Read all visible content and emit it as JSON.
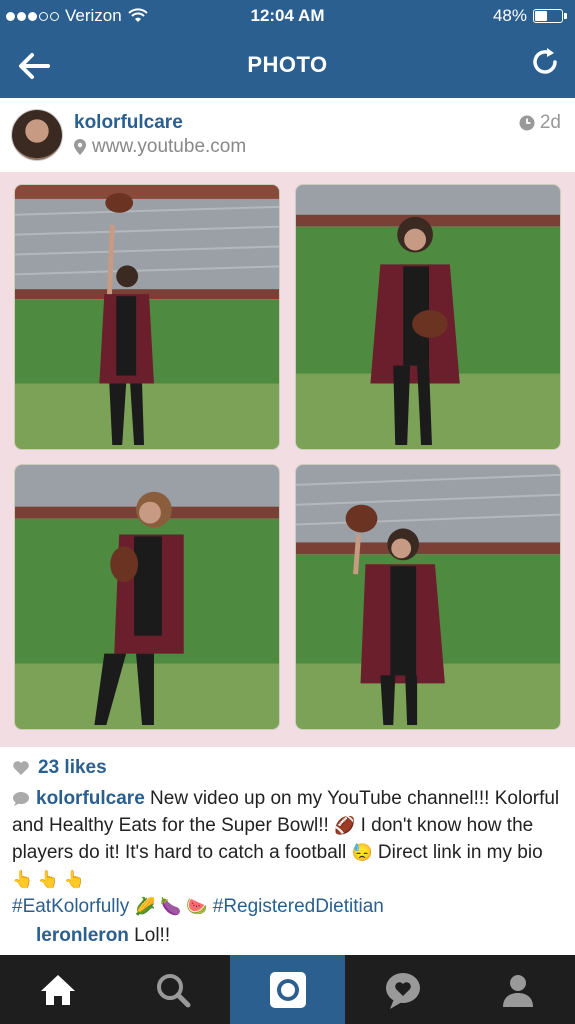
{
  "status_bar": {
    "carrier": "Verizon",
    "time": "12:04 AM",
    "battery": "48%",
    "battery_level": 0.48
  },
  "nav": {
    "title": "PHOTO"
  },
  "post": {
    "username": "kolorfulcare",
    "location": "www.youtube.com",
    "age": "2d",
    "likes": "23 likes",
    "caption_user": "kolorfulcare",
    "caption_line1": " New video up on my YouTube channel!!! Kolorful and Healthy Eats for the Super Bowl!! ",
    "caption_line2": " I don't know how the players do it! It's hard to catch a football ",
    "caption_line3": " Direct link in my bio ",
    "emoji_football": "🏈",
    "emoji_sweat": "😓",
    "emoji_hands": "👆 👆 👆",
    "tag1": "#EatKolorfully",
    "emoji_veg": "🌽 🍆 🍉",
    "tag2": "#RegisteredDietitian",
    "comment_user": "leronleron",
    "comment_text": " Lol!!"
  },
  "tabs": [
    "home-icon",
    "search-icon",
    "camera-icon",
    "activity-icon",
    "profile-icon"
  ],
  "colors": {
    "brand_blue": "#2a5f8f",
    "tabbar": "#1e1e1e",
    "photo_border": "#f2dde2"
  }
}
